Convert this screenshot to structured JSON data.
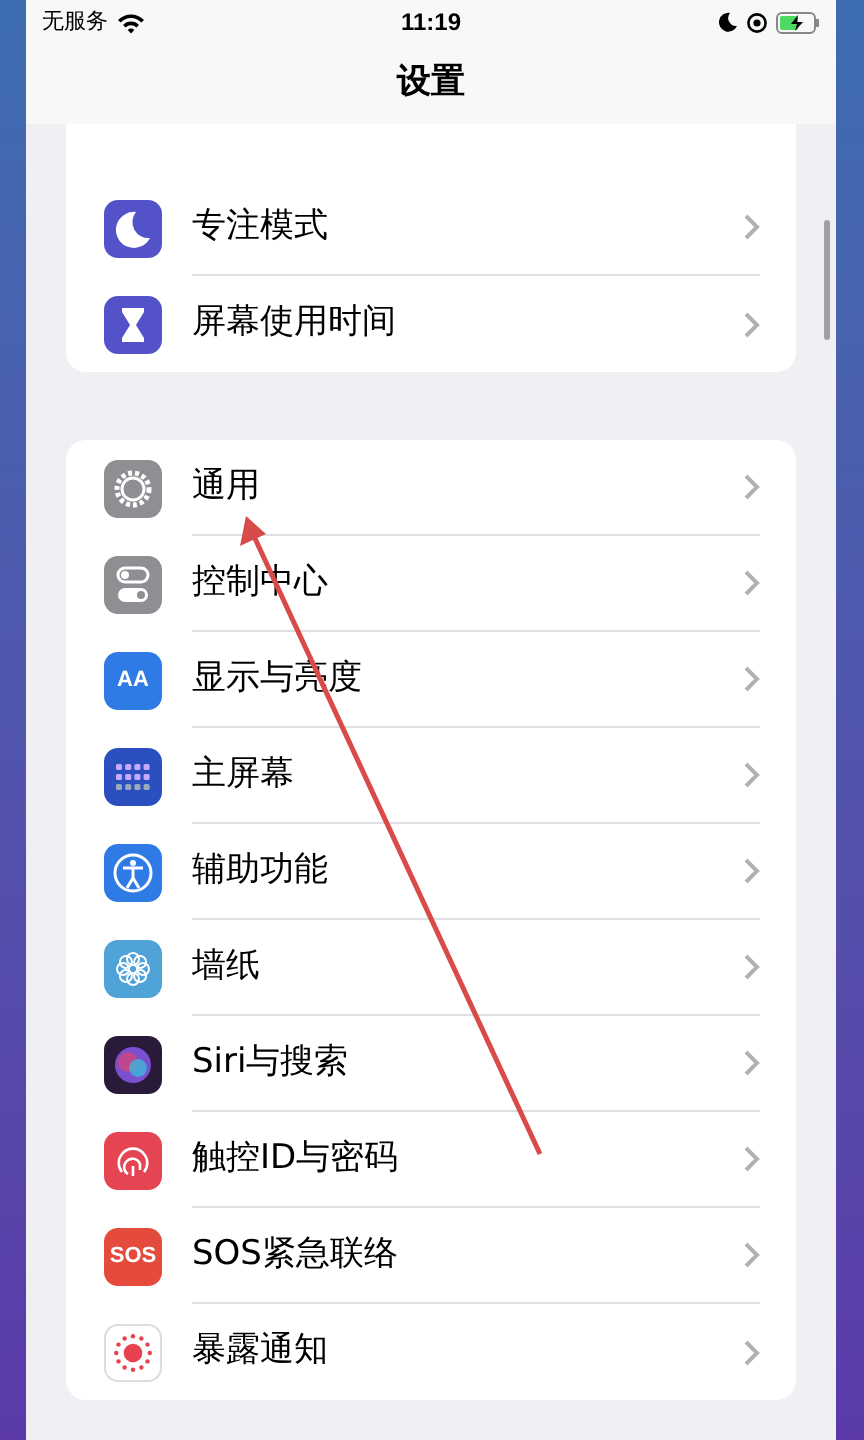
{
  "status_bar": {
    "carrier": "无服务",
    "time": "11:19"
  },
  "title": "设置",
  "groups": [
    {
      "items": [
        {
          "label": "专注模式",
          "kind": "moon",
          "color": "#5352c8"
        },
        {
          "label": "屏幕使用时间",
          "kind": "hourglass",
          "color": "#5352c8"
        }
      ]
    },
    {
      "items": [
        {
          "label": "通用",
          "kind": "gear",
          "color": "#8e8e93"
        },
        {
          "label": "控制中心",
          "kind": "toggles",
          "color": "#8e8e93"
        },
        {
          "label": "显示与亮度",
          "kind": "text",
          "text": "AA",
          "color": "#2f7be5"
        },
        {
          "label": "主屏幕",
          "kind": "grid",
          "color": "#2b4fbf"
        },
        {
          "label": "辅助功能",
          "kind": "person",
          "color": "#2f7be5"
        },
        {
          "label": "墙纸",
          "kind": "flower",
          "color": "#4fa3d9"
        },
        {
          "label": "Siri与搜索",
          "kind": "orb",
          "color": "#2a1a3a"
        },
        {
          "label": "触控ID与密码",
          "kind": "fingerprint",
          "color": "#e54452"
        },
        {
          "label": "SOS紧急联络",
          "kind": "text",
          "text": "SOS",
          "color": "#e54b3c"
        },
        {
          "label": "暴露通知",
          "kind": "dots",
          "color": "#ffffff"
        }
      ]
    }
  ]
}
